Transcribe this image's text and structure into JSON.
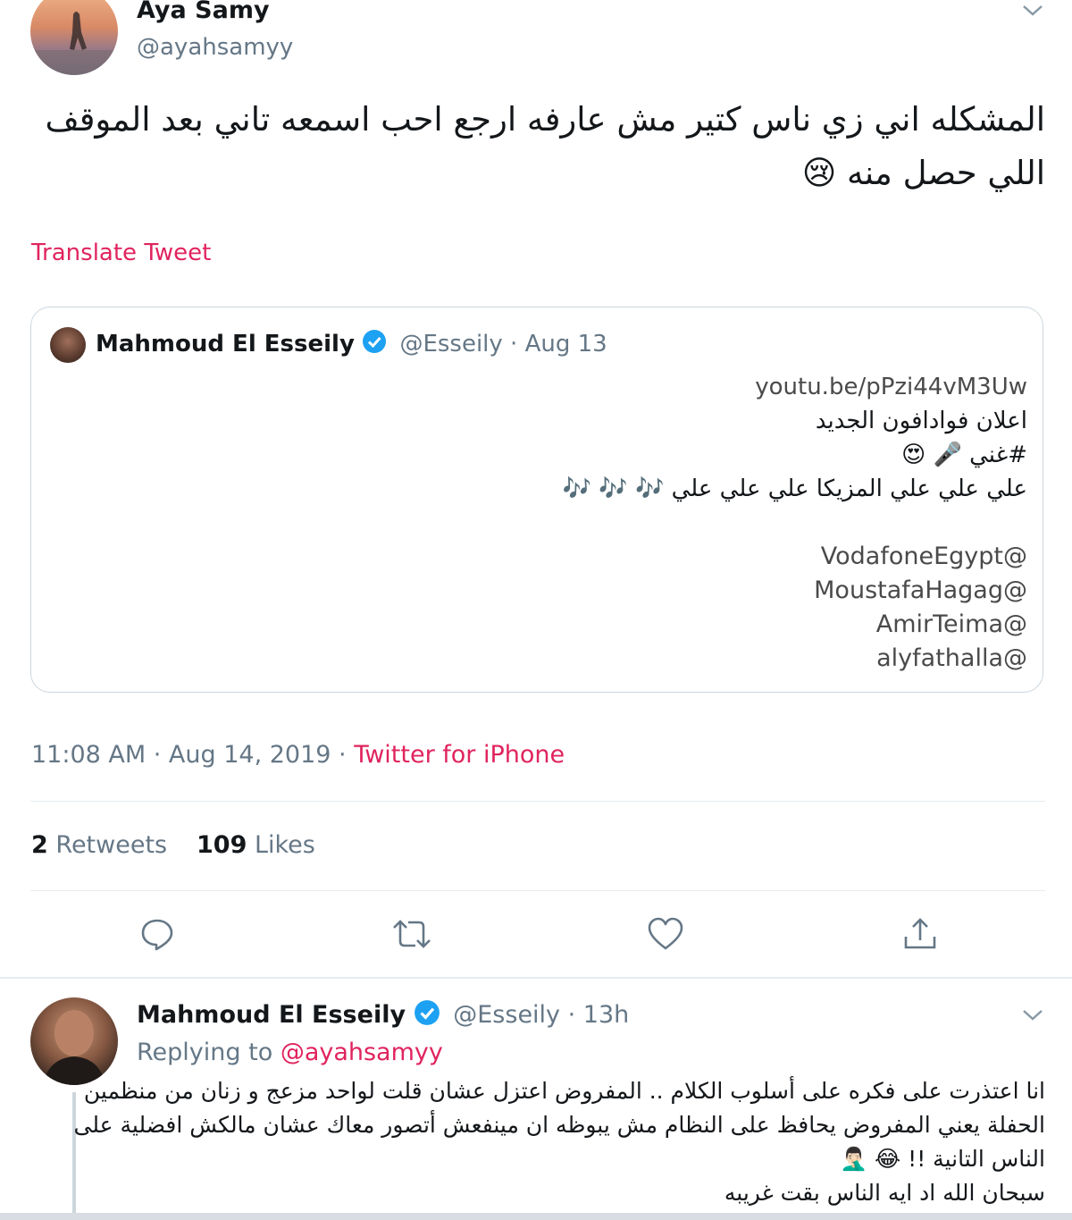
{
  "main_tweet": {
    "author_name": "Aya Samy",
    "author_handle": "@ayahsamyy",
    "text_line1": "المشكله اني زي ناس كتير مش عارفه ارجع احب اسمعه تاني بعد الموقف",
    "text_line2": "اللي حصل منه 😢",
    "translate_label": "Translate Tweet",
    "timestamp": "11:08 AM · Aug 14, 2019 · ",
    "source": "Twitter for iPhone",
    "retweets_count": "2",
    "retweets_label": "Retweets",
    "likes_count": "109",
    "likes_label": "Likes"
  },
  "quoted_tweet": {
    "author_name": "Mahmoud El Esseily",
    "author_handle_date": "@Esseily · Aug 13",
    "lines": [
      "youtu.be/pPzi44vM3Uw",
      "اعلان فوادافون الجديد",
      "#غني 🎤 😍",
      "علي علي علي المزيكا علي علي علي 🎶 🎶 🎶"
    ],
    "mentions": [
      "@VodafoneEgypt",
      "@MoustafaHagag",
      "@AmirTeima",
      "@alyfathalla"
    ]
  },
  "reply_tweet": {
    "author_name": "Mahmoud El Esseily",
    "author_handle_time": "@Esseily · 13h",
    "replying_prefix": "Replying to ",
    "replying_handle": "@ayahsamyy",
    "lines": [
      "انا اعتذرت على فكره على أسلوب الكلام .. المفروض اعتزل عشان قلت لواحد مزعج و زنان من منظمين",
      "الحفلة يعني المفروض يحافظ على النظام مش يبوظه ان مينفعش أتصور معاك عشان مالكش افضلية على",
      "الناس التانية !! 😂 🤦🏻‍♂️",
      "سبحان الله اد ايه الناس بقت غريبه"
    ]
  },
  "icons": {
    "reply": "reply-icon",
    "retweet": "retweet-icon",
    "like": "heart-icon",
    "share": "share-icon",
    "more": "chevron-down-icon",
    "verified": "verified-badge-icon"
  },
  "colors": {
    "link": "#e0245e",
    "muted": "#657786",
    "verified": "#1da1f2",
    "divider": "#e6ecf0"
  }
}
